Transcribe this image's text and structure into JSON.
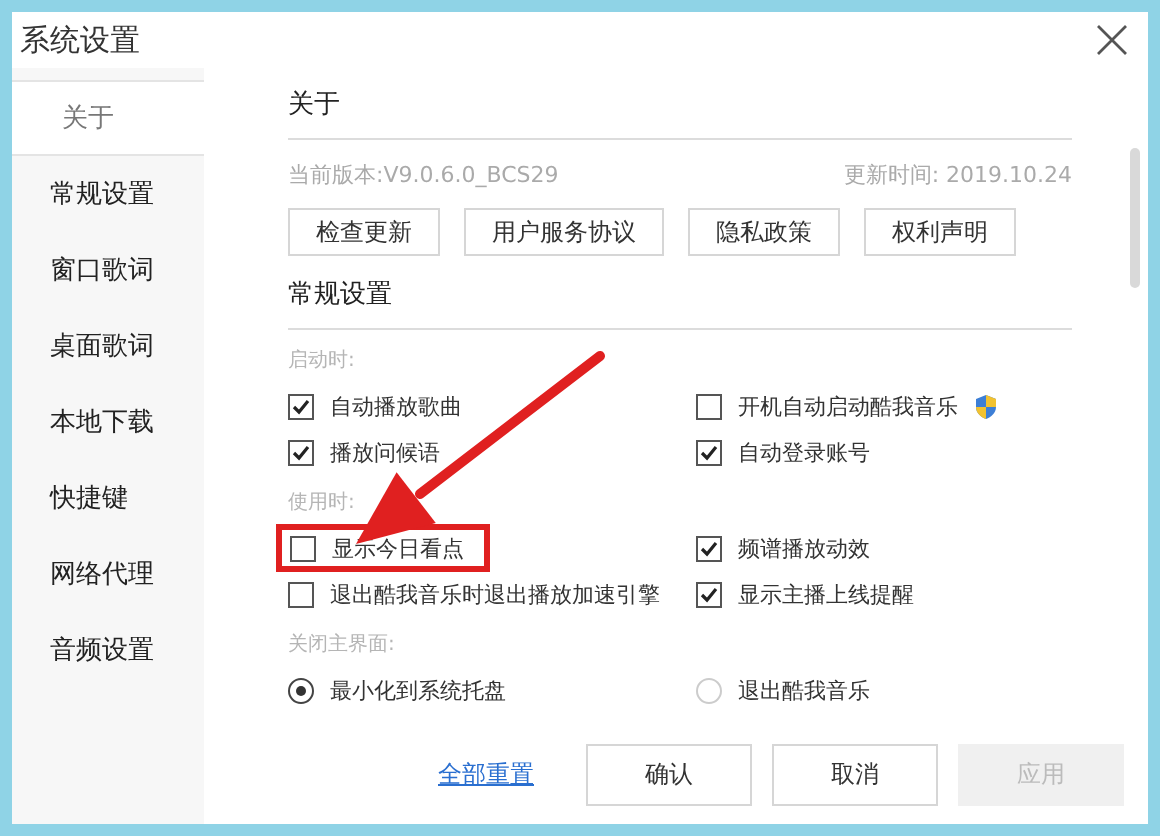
{
  "window": {
    "title": "系统设置"
  },
  "sidebar": {
    "items": [
      {
        "label": "关于",
        "selected": true
      },
      {
        "label": "常规设置",
        "selected": false
      },
      {
        "label": "窗口歌词",
        "selected": false
      },
      {
        "label": "桌面歌词",
        "selected": false
      },
      {
        "label": "本地下载",
        "selected": false
      },
      {
        "label": "快捷键",
        "selected": false
      },
      {
        "label": "网络代理",
        "selected": false
      },
      {
        "label": "音频设置",
        "selected": false
      }
    ]
  },
  "about": {
    "heading": "关于",
    "version": "当前版本:V9.0.6.0_BCS29",
    "updated": "更新时间: 2019.10.24",
    "buttons": [
      "检查更新",
      "用户服务协议",
      "隐私政策",
      "权利声明"
    ]
  },
  "general": {
    "heading": "常规设置",
    "groups": [
      {
        "label": "启动时:",
        "kind": "checkbox",
        "options": [
          {
            "label": "自动播放歌曲",
            "checked": true
          },
          {
            "label": "开机自动启动酷我音乐",
            "checked": false,
            "shield": true
          },
          {
            "label": "播放问候语",
            "checked": true
          },
          {
            "label": "自动登录账号",
            "checked": true
          }
        ]
      },
      {
        "label": "使用时:",
        "kind": "checkbox",
        "options": [
          {
            "label": "显示今日看点",
            "checked": false,
            "highlighted": true
          },
          {
            "label": "频谱播放动效",
            "checked": true
          },
          {
            "label": "退出酷我音乐时退出播放加速引擎",
            "checked": false
          },
          {
            "label": "显示主播上线提醒",
            "checked": true
          }
        ]
      },
      {
        "label": "关闭主界面:",
        "kind": "radio",
        "options": [
          {
            "label": "最小化到系统托盘",
            "selected": true
          },
          {
            "label": "退出酷我音乐",
            "selected": false
          }
        ]
      }
    ]
  },
  "footer": {
    "reset_link": "全部重置",
    "buttons": [
      {
        "label": "确认",
        "disabled": false
      },
      {
        "label": "取消",
        "disabled": false
      },
      {
        "label": "应用",
        "disabled": true
      }
    ]
  }
}
